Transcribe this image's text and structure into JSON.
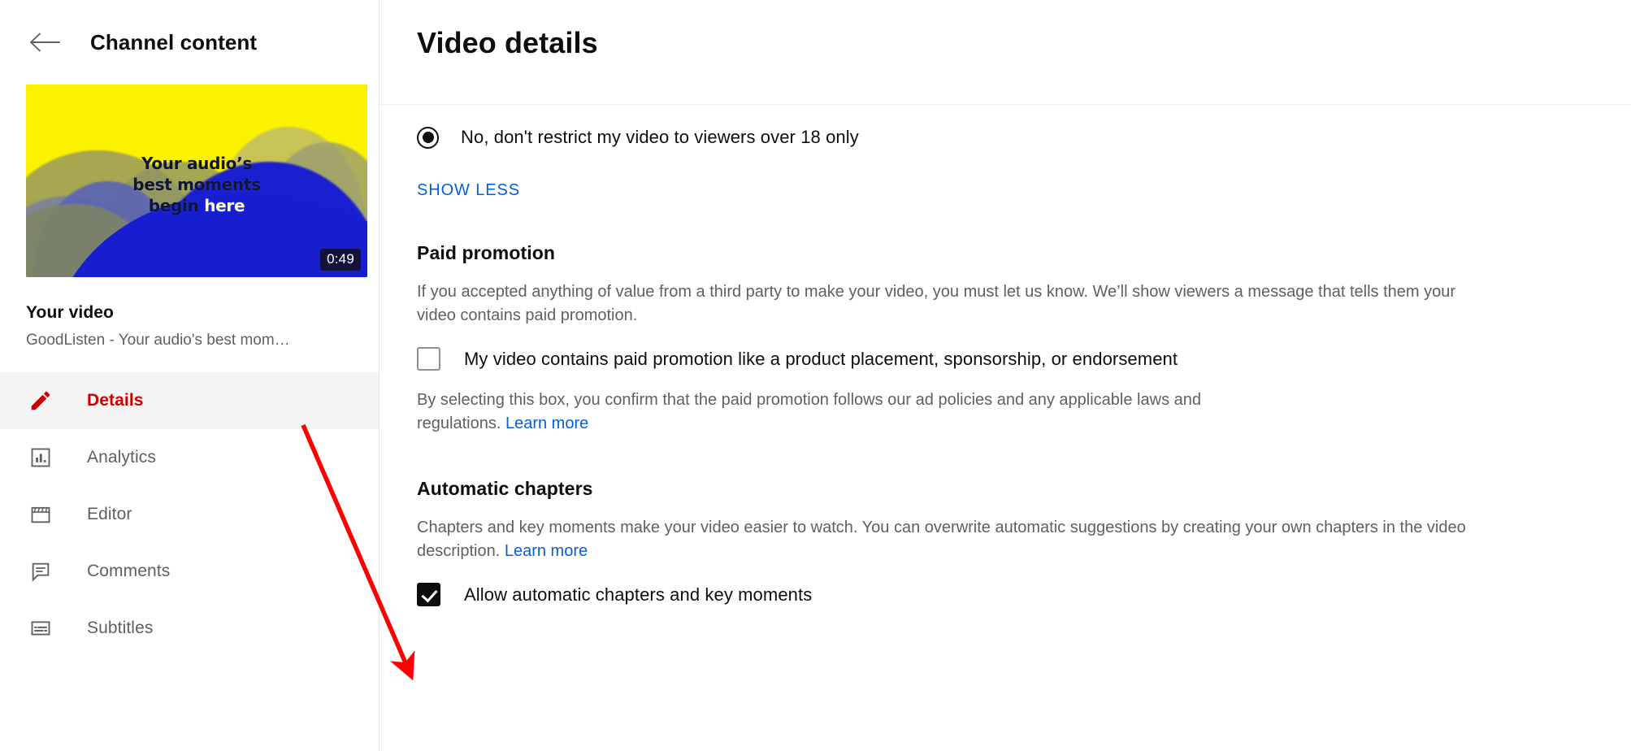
{
  "sidebar": {
    "back_icon": "back-arrow-icon",
    "header_title": "Channel content",
    "video": {
      "thumbnail_line1": "Your audio’s",
      "thumbnail_line2": "best moments",
      "thumbnail_line3_pre": "begin ",
      "thumbnail_line3_hl": "here",
      "duration": "0:49",
      "title": "Your video",
      "subtitle": "GoodListen - Your audio's best mom…"
    },
    "nav_items": [
      {
        "label": "Details",
        "icon": "pencil-icon",
        "active": true
      },
      {
        "label": "Analytics",
        "icon": "bar-chart-icon",
        "active": false
      },
      {
        "label": "Editor",
        "icon": "clapperboard-icon",
        "active": false
      },
      {
        "label": "Comments",
        "icon": "comment-icon",
        "active": false
      },
      {
        "label": "Subtitles",
        "icon": "subtitles-icon",
        "active": false
      }
    ]
  },
  "main": {
    "title": "Video details",
    "age_restriction": {
      "selected_label": "No, don't restrict my video to viewers over 18 only",
      "show_less_label": "SHOW LESS"
    },
    "paid_promotion": {
      "heading": "Paid promotion",
      "description": "If you accepted anything of value from a third party to make your video, you must let us know. We’ll show viewers a message that tells them your video contains paid promotion.",
      "checkbox_label": "My video contains paid promotion like a product placement, sponsorship, or endorsement",
      "checked": false,
      "fine_print_pre": "By selecting this box, you confirm that the paid promotion follows our ad policies and any applicable laws and regulations. ",
      "fine_print_link": "Learn more"
    },
    "automatic_chapters": {
      "heading": "Automatic chapters",
      "description_pre": "Chapters and key moments make your video easier to watch. You can overwrite automatic suggestions by creating your own chapters in the video description. ",
      "description_link": "Learn more",
      "checkbox_label": "Allow automatic chapters and key moments",
      "checked": true
    }
  },
  "annotation": {
    "type": "arrow",
    "color": "#ff0000",
    "points_to": "allow-automatic-chapters-checkbox"
  },
  "colors": {
    "brand_red": "#cc0000",
    "link_blue": "#065fd4",
    "text_primary": "#0d0d0d",
    "text_secondary": "#606060",
    "active_row_bg": "#f5f5f5",
    "annotation_red": "#ff0000"
  }
}
